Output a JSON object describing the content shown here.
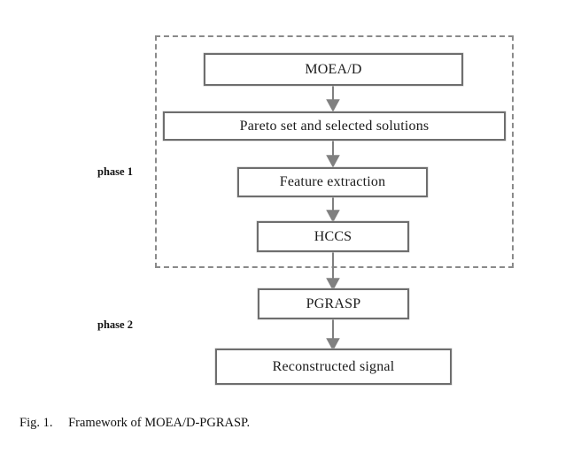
{
  "figure": {
    "caption_label": "Fig. 1.",
    "caption_text": "Framework of MOEA/D-PGRASP.",
    "nodes": [
      {
        "id": "moead",
        "label": "MOEA/D"
      },
      {
        "id": "pareto",
        "label": "Pareto set and selected solutions"
      },
      {
        "id": "feature",
        "label": "Feature extraction"
      },
      {
        "id": "hccs",
        "label": "HCCS"
      },
      {
        "id": "pgrasp",
        "label": "PGRASP"
      },
      {
        "id": "reconstructed",
        "label": "Reconstructed signal"
      }
    ],
    "phases": [
      {
        "id": "phase-1",
        "label": "phase 1"
      },
      {
        "id": "phase-2",
        "label": "phase 2"
      }
    ],
    "colors": {
      "node_border": "#6e6e6e",
      "node_fill": "#ffffff",
      "arrow": "#808080",
      "dashed_border": "#8a8a8a",
      "text": "#1b1b1b",
      "background": "#ffffff"
    }
  }
}
